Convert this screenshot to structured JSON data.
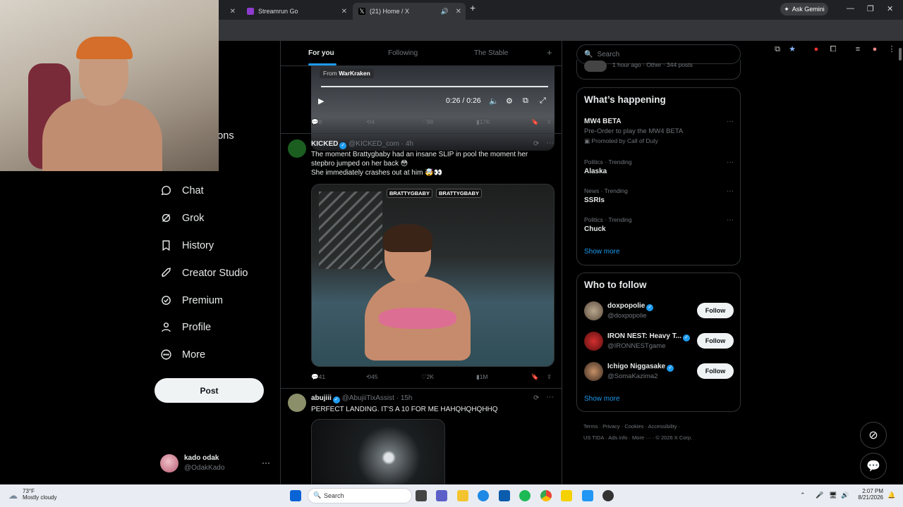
{
  "browser": {
    "tabs": [
      {
        "label": ""
      },
      {
        "label": "Streamrun Go"
      },
      {
        "label": "(21) Home / X"
      }
    ],
    "ask_gemini": "Ask Gemini",
    "colors": {
      "accent": "#1d9bf0",
      "bg": "#000000"
    }
  },
  "sidebar": {
    "partial_label": "ions",
    "items": [
      {
        "label": "Chat",
        "icon": "chat-icon"
      },
      {
        "label": "Grok",
        "icon": "grok-icon"
      },
      {
        "label": "History",
        "icon": "bookmark-icon"
      },
      {
        "label": "Creator Studio",
        "icon": "rocket-icon"
      },
      {
        "label": "Premium",
        "icon": "verified-icon"
      },
      {
        "label": "Profile",
        "icon": "person-icon"
      },
      {
        "label": "More",
        "icon": "more-circle-icon"
      }
    ],
    "post_label": "Post",
    "account": {
      "name": "kado odak",
      "handle": "@OdakKado"
    }
  },
  "feed": {
    "tabs": [
      "For you",
      "Following",
      "The Stable"
    ],
    "video1": {
      "from_prefix": "From",
      "from_name": "WarKraken",
      "time": "0:26 / 0:26"
    },
    "tweet1_actions": {
      "replies": "8",
      "reposts": "4",
      "likes": "98",
      "views": "17K"
    },
    "tweet2": {
      "name": "KICKED",
      "handle_time": "@KICKED_com · 4h",
      "text1": "The moment Brattygbaby had an insane SLIP in pool the moment her stepbro jumped on her back 😳",
      "text2": "She immediately crashes out at him 🤯👀",
      "tag1": "BRATTYGBABY",
      "tag2": "BRATTYGBABY",
      "actions": {
        "replies": "41",
        "reposts": "45",
        "likes": "2K",
        "views": "1M"
      }
    },
    "tweet3": {
      "name": "abujiii",
      "handle_time": "@AbujiiTixAssist · 15h",
      "text": "PERFECT LANDING. IT'S A 10 FOR ME HAHQHQHQHHQ"
    }
  },
  "right": {
    "search_placeholder": "Search",
    "top_partial": "1 hour ago · Other · 344 posts",
    "whats_happening": {
      "title": "What’s happening",
      "promo": {
        "name": "MW4 BETA",
        "desc": "Pre-Order to play the MW4 BETA",
        "promoted": "Promoted by Call of Duty"
      },
      "trends": [
        {
          "cat": "Politics · Trending",
          "name": "Alaska"
        },
        {
          "cat": "News · Trending",
          "name": "SSRIs"
        },
        {
          "cat": "Politics · Trending",
          "name": "Chuck"
        }
      ],
      "show_more": "Show more"
    },
    "who_to_follow": {
      "title": "Who to follow",
      "users": [
        {
          "name": "doxpopolie",
          "handle": "@doxpopolie"
        },
        {
          "name": "IRON NEST: Heavy T...",
          "handle": "@IRONNESTgame"
        },
        {
          "name": "Ichigo Niggasake",
          "handle": "@SomaKazima2"
        }
      ],
      "follow_label": "Follow",
      "show_more": "Show more"
    },
    "footer": {
      "line1": "Terms  ·  Privacy  ·  Cookies  ·  Accessibility  ·",
      "line2": "US TIDA  ·  Ads info  ·  More ···  ·  © 2026 X Corp."
    }
  },
  "taskbar": {
    "temp": "73°F",
    "weather": "Mostly cloudy",
    "search": "Search",
    "time": "2:07 PM",
    "date": "8/21/2026"
  }
}
